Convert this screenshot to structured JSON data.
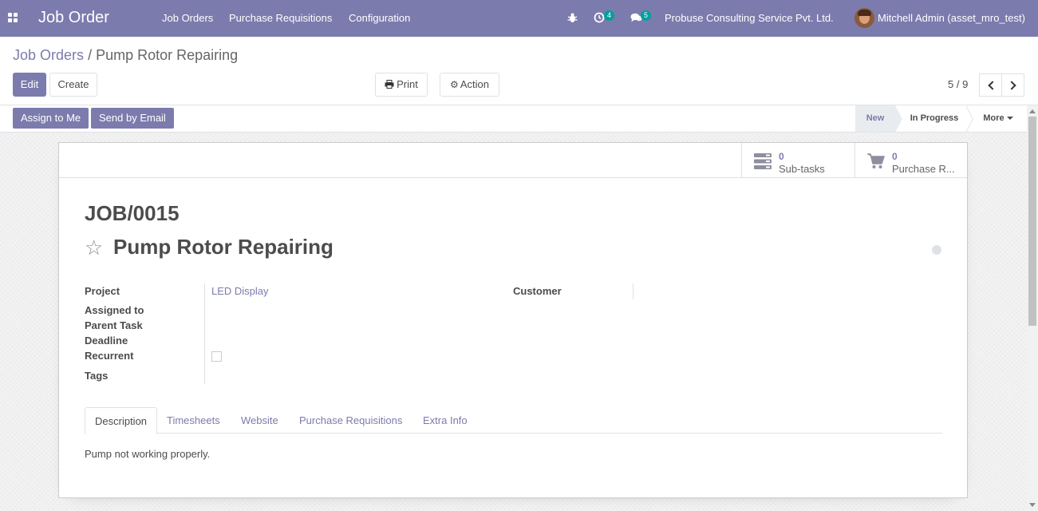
{
  "navbar": {
    "app_title": "Job Order",
    "menu": [
      "Job Orders",
      "Purchase Requisitions",
      "Configuration"
    ],
    "activity_count": "4",
    "messages_count": "5",
    "company": "Probuse Consulting Service Pvt. Ltd.",
    "user": "Mitchell Admin (asset_mro_test)",
    "color": "#7c7bad"
  },
  "breadcrumb": {
    "parent": "Job Orders",
    "separator": "/",
    "current": "Pump Rotor Repairing"
  },
  "buttons": {
    "edit": "Edit",
    "create": "Create",
    "print": "Print",
    "action": "Action"
  },
  "pager": {
    "value": "5 / 9"
  },
  "statusbar": {
    "assign": "Assign to Me",
    "send_email": "Send by Email",
    "stages": [
      "New",
      "In Progress",
      "More"
    ],
    "active_stage": "New"
  },
  "stat_buttons": {
    "subtasks": {
      "value": "0",
      "label": "Sub-tasks"
    },
    "purchase": {
      "value": "0",
      "label": "Purchase R..."
    }
  },
  "record": {
    "reference": "JOB/0015",
    "name": "Pump Rotor Repairing",
    "fields": {
      "project_label": "Project",
      "project_value": "LED Display",
      "customer_label": "Customer",
      "assigned_label": "Assigned to",
      "parent_label": "Parent Task",
      "deadline_label": "Deadline",
      "recurrent_label": "Recurrent",
      "recurrent_value": false,
      "tags_label": "Tags"
    }
  },
  "tabs": [
    "Description",
    "Timesheets",
    "Website",
    "Purchase Requisitions",
    "Extra Info"
  ],
  "description": "Pump not working properly."
}
